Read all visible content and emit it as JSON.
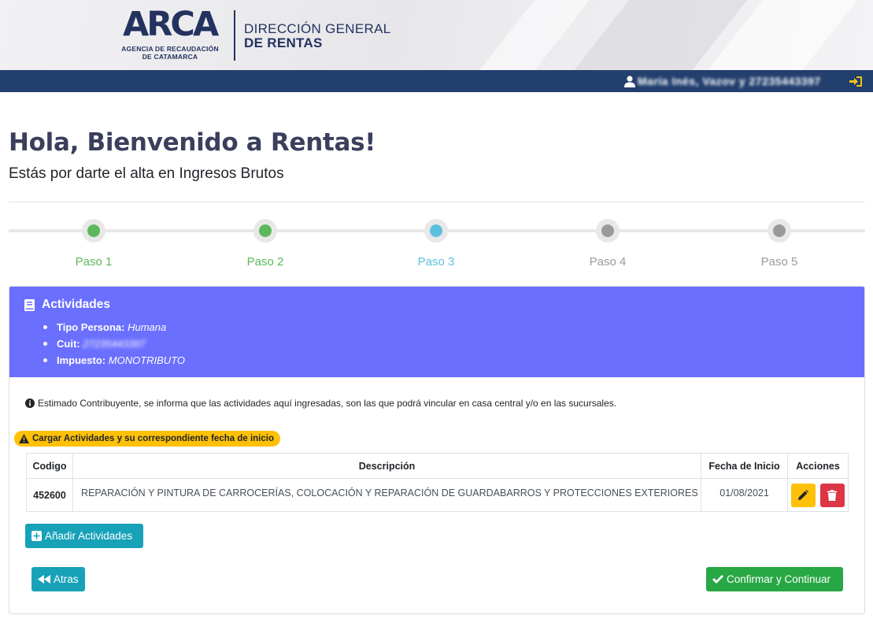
{
  "header": {
    "logo": "ARCA",
    "logo_sub_line1": "AGENCIA DE RECAUDACIÓN",
    "logo_sub_line2": "DE CATAMARCA",
    "org_line1": "DIRECCIÓN GENERAL",
    "org_line2": "DE RENTAS",
    "user_name": "María Inés, Vazov y 27235443397"
  },
  "title": "Hola, Bienvenido a Rentas!",
  "subtitle": "Estás por darte el alta en Ingresos Brutos",
  "steps": [
    {
      "label": "Paso 1",
      "status": "completed",
      "color": "#5cb85c"
    },
    {
      "label": "Paso 2",
      "status": "completed",
      "color": "#5cb85c"
    },
    {
      "label": "Paso 3",
      "status": "current",
      "color": "#5bc0de"
    },
    {
      "label": "Paso 4",
      "status": "pending",
      "color": "#999999"
    },
    {
      "label": "Paso 5",
      "status": "pending",
      "color": "#999999"
    }
  ],
  "card": {
    "title": "Actividades",
    "tipo_persona_label": "Tipo Persona:",
    "tipo_persona_value": "Humana",
    "cuit_label": "Cuit:",
    "cuit_value": "27235443397",
    "impuesto_label": "Impuesto:",
    "impuesto_value": "MONOTRIBUTO",
    "notice": "Estimado Contribuyente, se informa que las actividades aquí ingresadas, son las que podrá vincular en casa central y/o en las sucursales.",
    "warning": "Cargar Actividades y su correspondiente fecha de inicio"
  },
  "table": {
    "headers": {
      "code": "Codigo",
      "description": "Descripción",
      "start_date": "Fecha de Inicio",
      "actions": "Acciones"
    },
    "rows": [
      {
        "code": "452600",
        "description": "REPARACIÓN Y PINTURA DE CARROCERÍAS, COLOCACIÓN Y REPARACIÓN DE GUARDABARROS Y PROTECCIONES EXTERIORES",
        "start_date": "01/08/2021"
      }
    ]
  },
  "buttons": {
    "add": "Añadir Actividades",
    "back": "Atras",
    "confirm": "Confirmar y Continuar"
  },
  "colors": {
    "navy": "#223f6e",
    "card_header": "#6b6ffe",
    "info": "#17a2b8",
    "success": "#28a745",
    "warning": "#ffc107",
    "danger": "#dc3545"
  }
}
